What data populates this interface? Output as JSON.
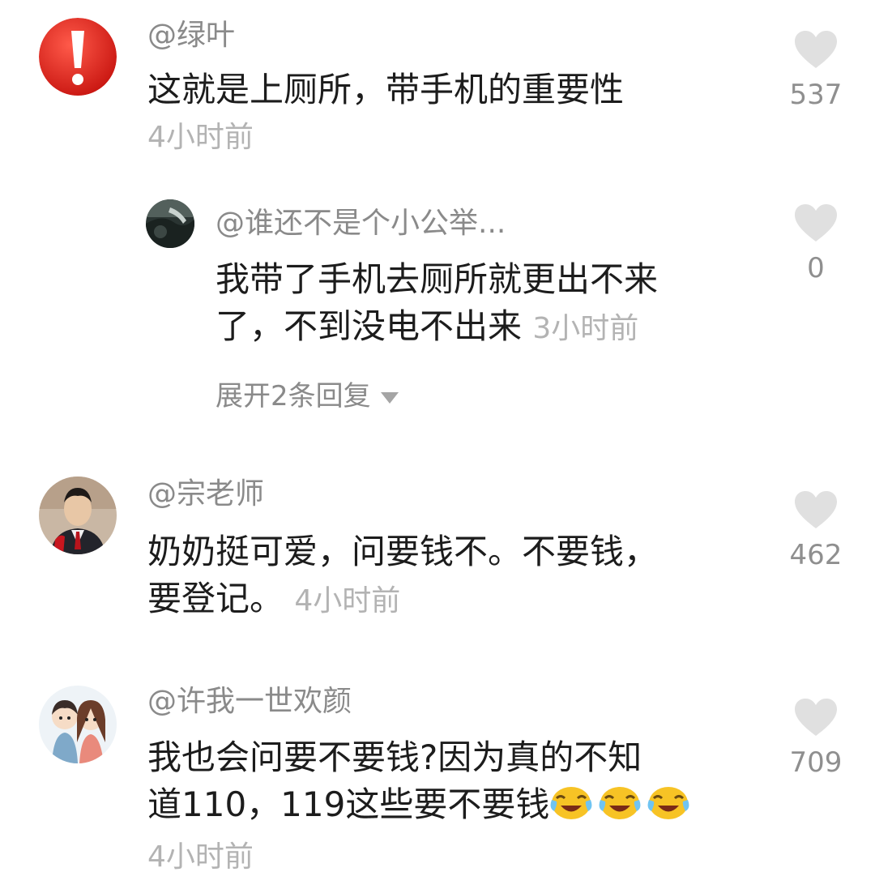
{
  "comments": [
    {
      "username": "@绿叶",
      "text": "这就是上厕所，带手机的重要性",
      "time": "4小时前",
      "likes": "537",
      "reply": {
        "username": "@谁还不是个小公举...",
        "text_line1": "我带了手机去厕所就更出不来",
        "text_line2": "了，不到没电不出来",
        "time": "3小时前",
        "likes": "0"
      },
      "expand_label": "展开2条回复"
    },
    {
      "username": "@宗老师",
      "text_line1": "奶奶挺可爱，问要钱不。不要钱，",
      "text_line2": "要登记。",
      "time": "4小时前",
      "likes": "462"
    },
    {
      "username": "@许我一世欢颜",
      "text_line1": "我也会问要不要钱?因为真的不知",
      "text_line2": "道110，119这些要不要钱",
      "emoji": [
        "laughing-crying-emoji",
        "laughing-crying-emoji",
        "laughing-crying-emoji"
      ],
      "time": "4小时前",
      "likes": "709"
    }
  ],
  "colors": {
    "heart": "#e0e0e0",
    "username": "#8a8a8a",
    "time": "#b3b3b3",
    "avatar_red": "#e8231a"
  }
}
